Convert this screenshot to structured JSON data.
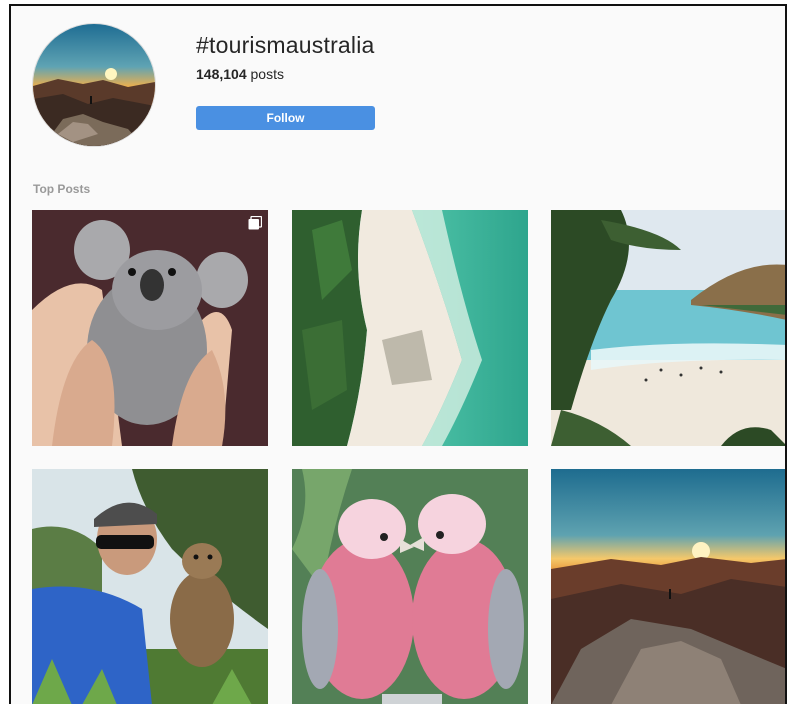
{
  "hashtag": {
    "title": "#tourismaustralia",
    "post_count": "148,104",
    "post_suffix": "posts",
    "follow_label": "Follow",
    "avatar_icon": "sunset-mountain-avatar"
  },
  "section": {
    "label": "Top Posts"
  },
  "posts": [
    {
      "subject": "koala-photo",
      "multi": true
    },
    {
      "subject": "aerial-beach-photo",
      "multi": false
    },
    {
      "subject": "beach-coast-photo",
      "multi": false
    },
    {
      "subject": "quokka-selfie-photo",
      "multi": false
    },
    {
      "subject": "galah-parrots-photo",
      "multi": false
    },
    {
      "subject": "mountain-sunset-photo",
      "multi": false
    }
  ],
  "colors": {
    "follow_button": "#4a90e2",
    "background": "#fafafa",
    "title_text": "#262626",
    "section_label": "#999999"
  }
}
